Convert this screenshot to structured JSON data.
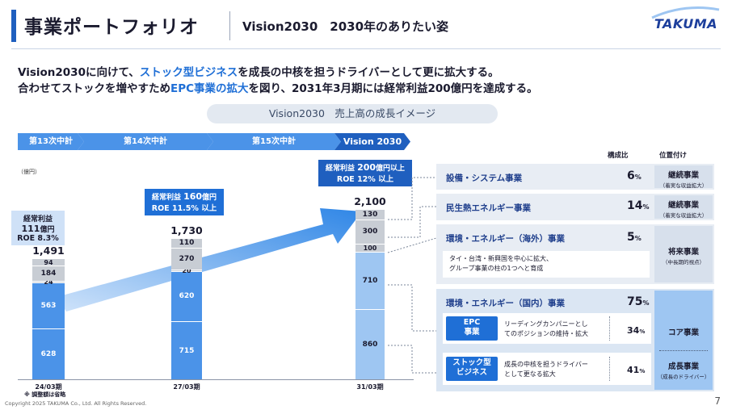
{
  "header": {
    "title": "事業ポートフォリオ",
    "subtitle": "Vision2030　2030年のありたい姿",
    "logo": "TAKUMA"
  },
  "lead": {
    "line1_a": "Vision2030に向けて、",
    "line1_hl": "ストック型ビジネス",
    "line1_b": "を成長の中核を担うドライバーとして更に拡大する。",
    "line2_a": "合わせてストックを増やすため",
    "line2_hl": "EPC事業の拡大",
    "line2_b": "を図り、2031年3月期には経常利益200億円を達成する。"
  },
  "pill": "Vision2030　売上高の成長イメージ",
  "plans": [
    "第13次中計",
    "第14次中計",
    "第15次中計",
    "Vision 2030"
  ],
  "unit": "（億円）",
  "chart_data": {
    "type": "bar",
    "stacked": true,
    "categories": [
      "24/03期",
      "27/03期",
      "31/03期"
    ],
    "totals": [
      "1,491",
      "1,730",
      "2,100"
    ],
    "series": [
      {
        "values": [
          628,
          715,
          860
        ]
      },
      {
        "values": [
          563,
          620,
          710
        ]
      },
      {
        "values": [
          24,
          20,
          100
        ]
      },
      {
        "values": [
          184,
          270,
          300
        ]
      },
      {
        "values": [
          94,
          110,
          130
        ]
      }
    ],
    "callouts": [
      {
        "l1a": "経常利益",
        "l1b": "111",
        "l1c": "億円",
        "l2": "ROE 8.3%"
      },
      {
        "l1a": "経常利益",
        "l1b": "160",
        "l1c": "億円",
        "l2": "ROE 11.5% 以上"
      },
      {
        "l1a": "経常利益",
        "l1b": "200",
        "l1c": "億円以上",
        "l2": "ROE 12% 以上"
      }
    ]
  },
  "note": "※ 調整額は省略",
  "right": {
    "col_ratio": "構成比",
    "col_position": "位置付け",
    "rows": [
      {
        "name": "設備・システム事業",
        "pct": "6",
        "unit": "%",
        "pos_a": "継続事業",
        "pos_b": "（着実な収益拡大）"
      },
      {
        "name": "民生熱エネルギー事業",
        "pct": "14",
        "unit": "%",
        "pos_a": "継続事業",
        "pos_b": "（着実な収益拡大）"
      },
      {
        "name": "環境・エネルギー（海外）事業",
        "pct": "5",
        "unit": "%",
        "pos_a": "将来事業",
        "pos_b": "（中長期的視点）",
        "desc1": "タイ・台湾・新興国を中心に拡大、",
        "desc2": "グループ事業の柱の1つへと育成"
      },
      {
        "name": "環境・エネルギー（国内）事業",
        "pct": "75",
        "unit": "%"
      }
    ],
    "sub": [
      {
        "tag1": "EPC",
        "tag2": "事業",
        "desc1": "リーディングカンパニーとし",
        "desc2": "てのポジションの維持・拡大",
        "pct": "34",
        "unit": "%",
        "pos_a": "コア事業"
      },
      {
        "tag1": "ストック型",
        "tag2": "ビジネス",
        "desc1": "成長の中核を担うドライバー",
        "desc2": "として更なる拡大",
        "pct": "41",
        "unit": "%",
        "pos_a": "成長事業",
        "pos_b": "（成長のドライバー）"
      }
    ]
  },
  "footer": {
    "copyright": "Copyright 2025 TAKUMA Co., Ltd. All Rights Reserved.",
    "page": "7"
  },
  "colors": {
    "primary": "#1f6fd6",
    "bar_dark": "#4b93e8",
    "bar_light": "#9ec6f2",
    "grey": "#c8cdd4"
  }
}
